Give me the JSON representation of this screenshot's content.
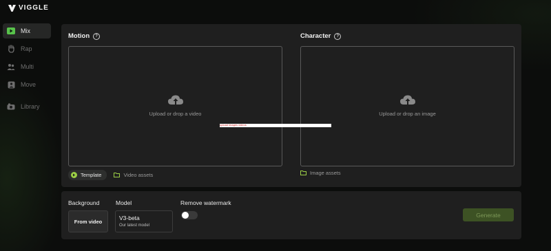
{
  "app": {
    "brand": "VIGGLE"
  },
  "sidebar": {
    "items": [
      {
        "label": "Mix",
        "icon": "play-icon",
        "active": true
      },
      {
        "label": "Rap",
        "icon": "hand-icon",
        "active": false
      },
      {
        "label": "Multi",
        "icon": "users-icon",
        "active": false
      },
      {
        "label": "Move",
        "icon": "move-icon",
        "active": false
      },
      {
        "label": "Library",
        "icon": "library-icon",
        "active": false
      }
    ]
  },
  "motion": {
    "title": "Motion",
    "dropzone_text": "Upload or drop a video",
    "template_label": "Template",
    "assets_label": "Video assets"
  },
  "character": {
    "title": "Character",
    "dropzone_text": "Upload or drop an image",
    "assets_label": "Image assets"
  },
  "overlay": {
    "text": "upload images videos"
  },
  "options": {
    "background_label": "Background",
    "background_value": "From video",
    "model_label": "Model",
    "model_name": "V3-beta",
    "model_desc": "Our latest model",
    "watermark_label": "Remove watermark",
    "watermark_on": false
  },
  "actions": {
    "generate_label": "Generate"
  },
  "colors": {
    "accent": "#9ccf46",
    "generate_bg": "#3d5224",
    "panel": "#1f1f1f"
  }
}
